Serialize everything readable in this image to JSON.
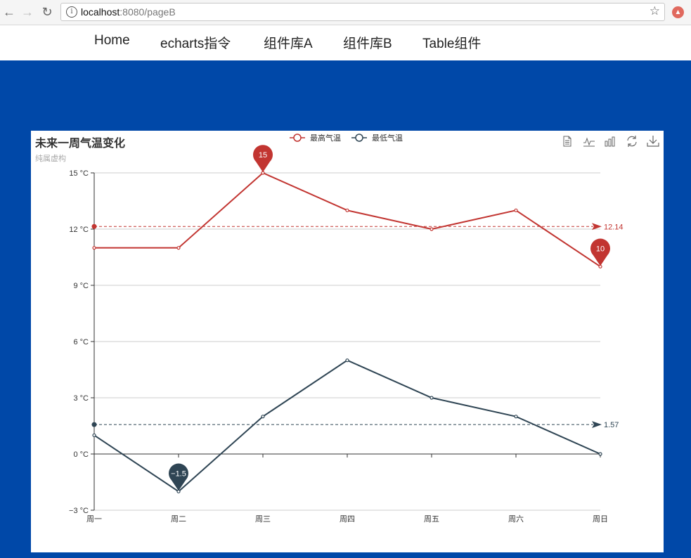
{
  "browser": {
    "url_host": "localhost",
    "url_rest": ":8080/pageB",
    "info_glyph": "i",
    "star_glyph": "☆"
  },
  "nav": {
    "items": [
      {
        "label": "Home"
      },
      {
        "label": "echarts指令"
      },
      {
        "label": "组件库A"
      },
      {
        "label": "组件库B"
      },
      {
        "label": "Table组件"
      }
    ]
  },
  "chart": {
    "title": "未来一周气温变化",
    "subtitle": "纯属虚构",
    "toolbox": [
      "data-view-icon",
      "line-chart-icon",
      "bar-chart-icon",
      "restore-icon",
      "save-image-icon"
    ]
  },
  "chart_data": {
    "type": "line",
    "title": "未来一周气温变化",
    "subtitle": "纯属虚构",
    "categories": [
      "周一",
      "周二",
      "周三",
      "周四",
      "周五",
      "周六",
      "周日"
    ],
    "ylim": [
      -3,
      15
    ],
    "yticks": [
      -3,
      0,
      3,
      6,
      9,
      12,
      15
    ],
    "ytick_labels": [
      "−3 °C",
      "0 °C",
      "3 °C",
      "6 °C",
      "9 °C",
      "12 °C",
      "15 °C"
    ],
    "grid": true,
    "legend_position": "top-center",
    "series": [
      {
        "name": "最高气温",
        "color": "#c23531",
        "values": [
          11,
          11,
          15,
          13,
          12,
          13,
          10
        ],
        "mark_points": [
          {
            "type": "max",
            "category": "周三",
            "value": 15,
            "label": "15"
          },
          {
            "type": "min",
            "category": "周日",
            "value": 10,
            "label": "10"
          }
        ],
        "mark_line": {
          "type": "average",
          "value": 12.14,
          "label": "12.14"
        }
      },
      {
        "name": "最低气温",
        "color": "#2f4554",
        "values": [
          1,
          -2,
          2,
          5,
          3,
          2,
          0
        ],
        "mark_points": [
          {
            "type": "min",
            "category": "周二",
            "value": -2,
            "label": "−1.5"
          }
        ],
        "mark_line": {
          "type": "average",
          "value": 1.57,
          "label": "1.57"
        }
      }
    ]
  }
}
